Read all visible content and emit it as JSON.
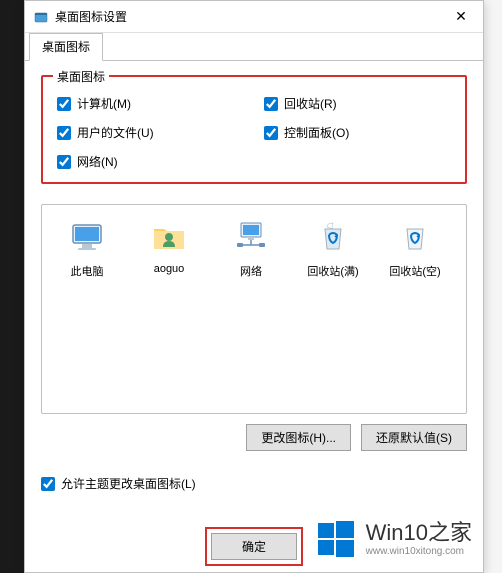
{
  "titlebar": {
    "title": "桌面图标设置"
  },
  "tabs": {
    "primary": "桌面图标"
  },
  "group": {
    "title": "桌面图标",
    "computer": "计算机(M)",
    "recycle": "回收站(R)",
    "userfiles": "用户的文件(U)",
    "controlpanel": "控制面板(O)",
    "network": "网络(N)"
  },
  "icons": {
    "thispc": "此电脑",
    "user": "aoguo",
    "network": "网络",
    "recycle_full": "回收站(满)",
    "recycle_empty": "回收站(空)"
  },
  "buttons": {
    "change_icon": "更改图标(H)...",
    "restore_default": "还原默认值(S)",
    "ok": "确定"
  },
  "allow_theme": "允许主题更改桌面图标(L)",
  "watermark": {
    "brand": "Win10之家",
    "url": "www.win10xitong.com"
  }
}
